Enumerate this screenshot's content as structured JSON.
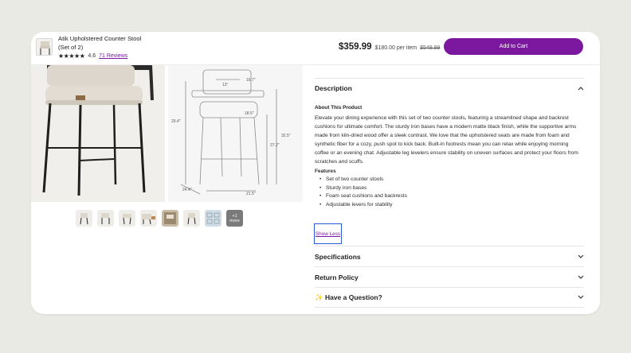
{
  "header": {
    "title_line1": "Atik Upholstered Counter Stool",
    "title_line2": "(Set of 2)",
    "stars": "★★★★★",
    "rating": "4.6",
    "reviews_link": "71 Reviews",
    "price": "$359.99",
    "per_item": "$180.00 per item",
    "was_price": "$549.99",
    "add_to_cart": "Add to Cart"
  },
  "gallery": {
    "dimensions": {
      "d1": "13\"",
      "d2": "16.7\"",
      "d3": "18.5\"",
      "d4": "29.4\"",
      "d5": "32.5\"",
      "d6": "27.2\"",
      "d7": "24.4\"",
      "d8": "21.5\""
    },
    "more_label_line1": "+1",
    "more_label_line2": "more"
  },
  "sections": {
    "description": {
      "label": "Description",
      "about_title": "About This Product",
      "text": "Elevate your dining experience with this set of two counter stools, featuring a streamlined shape and backrest cushions for ultimate comfort. The sturdy iron bases have a modern matte black finish, while the supportive arms made from kiln-dried wood offer a sleek contrast. We love that the upholstered seats are made from foam and synthetic fiber for a cozy, push spot to kick back. Built-in footrests mean you can relax while enjoying morning coffee or an evening chat. Adjustable leg levelers ensure stability on uneven surfaces and protect your floors from scratches and scuffs.",
      "features_title": "Features",
      "features": [
        "Set of two counter stools",
        "Sturdy iron bases",
        "Foam seat cushions and backrests",
        "Adjustable levers for stability"
      ],
      "show_less": "Show Less"
    },
    "specifications": {
      "label": "Specifications"
    },
    "return_policy": {
      "label": "Return Policy"
    },
    "question": {
      "emoji": "✨",
      "label": "Have a Question?"
    }
  },
  "colors": {
    "accent": "#7b189f",
    "page_bg": "#e9eae3",
    "focus_ring": "#2a5bd7"
  }
}
